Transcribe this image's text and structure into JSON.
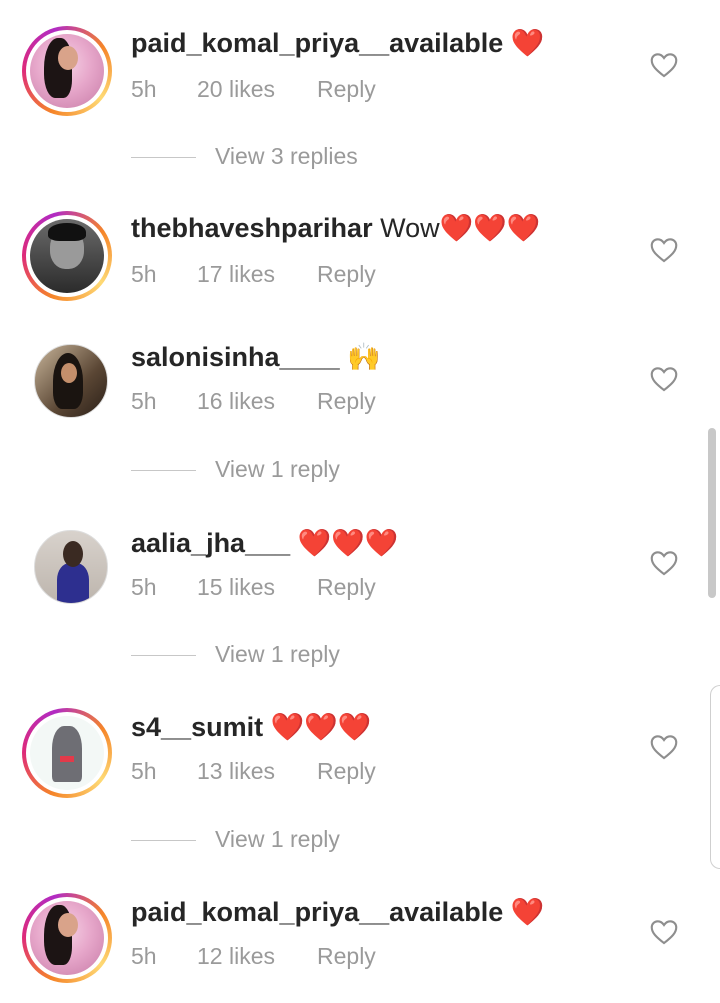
{
  "comments": [
    {
      "username": "paid_komal_priya__available",
      "text": " ❤️",
      "time": "5h",
      "likes": "20 likes",
      "reply": "Reply",
      "view_replies": "View 3 replies",
      "avatar_icon": "profile-photo",
      "story_ring": true
    },
    {
      "username": "thebhaveshparihar",
      "text": " Wow❤️❤️❤️",
      "time": "5h",
      "likes": "17 likes",
      "reply": "Reply",
      "view_replies": "",
      "avatar_icon": "profile-photo",
      "story_ring": true
    },
    {
      "username": "salonisinha____",
      "text": " 🙌",
      "time": "5h",
      "likes": "16 likes",
      "reply": "Reply",
      "view_replies": "View 1 reply",
      "avatar_icon": "profile-photo",
      "story_ring": false
    },
    {
      "username": "aalia_jha___",
      "text": " ❤️❤️❤️",
      "time": "5h",
      "likes": "15 likes",
      "reply": "Reply",
      "view_replies": "View 1 reply",
      "avatar_icon": "profile-photo",
      "story_ring": false
    },
    {
      "username": "s4__sumit",
      "text": " ❤️❤️❤️",
      "time": "5h",
      "likes": "13 likes",
      "reply": "Reply",
      "view_replies": "View 1 reply",
      "avatar_icon": "profile-photo",
      "story_ring": true
    },
    {
      "username": "paid_komal_priya__available",
      "text": " ❤️",
      "time": "5h",
      "likes": "12 likes",
      "reply": "Reply",
      "view_replies": "",
      "avatar_icon": "profile-photo",
      "story_ring": true
    }
  ],
  "icons": {
    "like": "heart-outline-icon"
  },
  "colors": {
    "text": "#262626",
    "meta": "#9a9a9a",
    "ring_start": "#f58529",
    "ring_end": "#dd2a7b"
  }
}
